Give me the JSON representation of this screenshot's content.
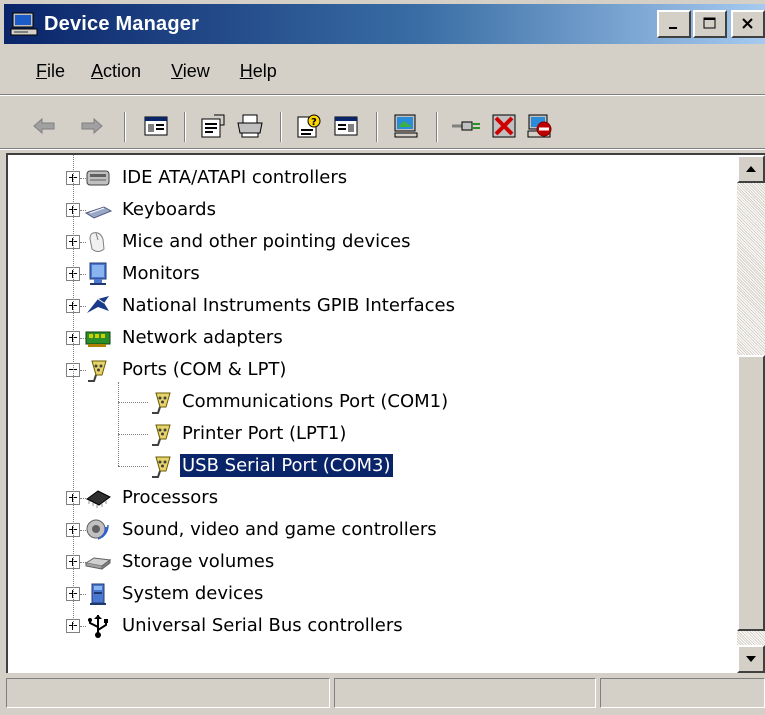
{
  "window": {
    "title": "Device Manager",
    "controls": [
      "_",
      "□",
      "X"
    ]
  },
  "menu": [
    {
      "label": "File",
      "underline": "F",
      "rest": "ile"
    },
    {
      "label": "Action",
      "underline": "A",
      "rest": "ction"
    },
    {
      "label": "View",
      "underline": "V",
      "rest": "iew"
    },
    {
      "label": "Help",
      "underline": "H",
      "rest": "elp"
    }
  ],
  "toolbar": {
    "buttons": [
      "back-arrow-icon",
      "forward-arrow-icon",
      "show-hide-console-tree-icon",
      "properties-icon",
      "print-icon",
      "help-icon",
      "show-hide-action-pane-icon",
      "scan-hardware-icon",
      "update-driver-icon",
      "uninstall-icon",
      "disable-device-icon"
    ]
  },
  "tree": {
    "items": [
      {
        "label": "IDE ATA/ATAPI controllers",
        "icon": "ide-controller-icon",
        "expander": "plus"
      },
      {
        "label": "Keyboards",
        "icon": "keyboard-icon",
        "expander": "plus"
      },
      {
        "label": "Mice and other pointing devices",
        "icon": "mouse-icon",
        "expander": "plus"
      },
      {
        "label": "Monitors",
        "icon": "monitor-icon",
        "expander": "plus"
      },
      {
        "label": "National Instruments GPIB Interfaces",
        "icon": "gpib-icon",
        "expander": "plus"
      },
      {
        "label": "Network adapters",
        "icon": "network-adapter-icon",
        "expander": "plus"
      },
      {
        "label": "Ports (COM & LPT)",
        "icon": "port-icon",
        "expander": "minus"
      },
      {
        "label": "Communications Port (COM1)",
        "icon": "port-icon",
        "child": true
      },
      {
        "label": "Printer Port (LPT1)",
        "icon": "port-icon",
        "child": true
      },
      {
        "label": "USB Serial Port (COM3)",
        "icon": "port-icon",
        "child": true,
        "selected": true
      },
      {
        "label": "Processors",
        "icon": "processor-icon",
        "expander": "plus"
      },
      {
        "label": "Sound, video and game controllers",
        "icon": "sound-icon",
        "expander": "plus"
      },
      {
        "label": "Storage volumes",
        "icon": "storage-volume-icon",
        "expander": "plus"
      },
      {
        "label": "System devices",
        "icon": "system-device-icon",
        "expander": "plus"
      },
      {
        "label": "Universal Serial Bus controllers",
        "icon": "usb-icon",
        "expander": "plus"
      }
    ]
  },
  "status": {
    "panes": [
      "",
      "",
      ""
    ]
  },
  "colors": {
    "titlebar_start": "#0a246a",
    "titlebar_end": "#a6caf0",
    "selection": "#0a246a",
    "face": "#d4d0c8"
  }
}
